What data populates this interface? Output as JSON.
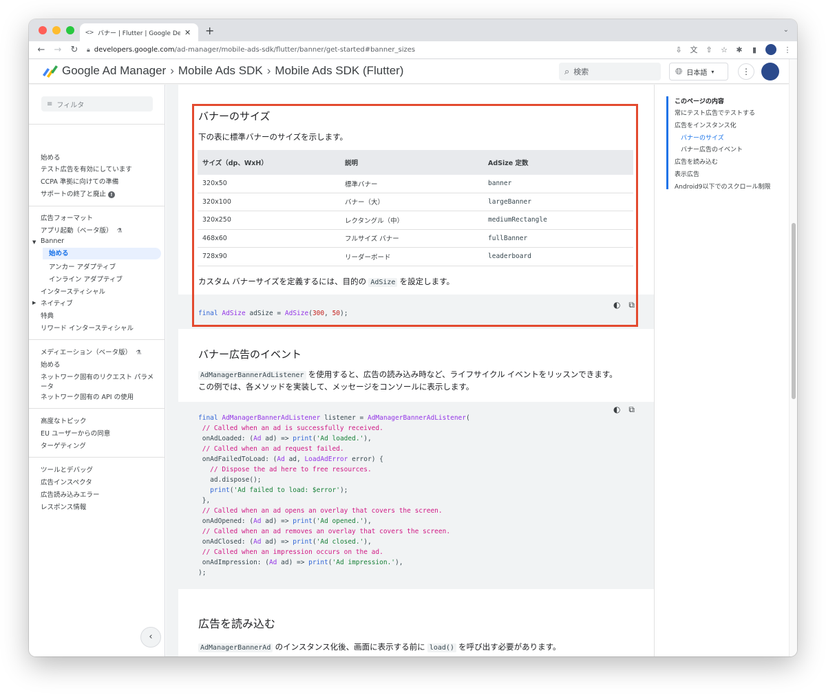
{
  "browser": {
    "tab_title": "バナー | Flutter | Google Developers",
    "tab_favicon": "<>",
    "tab_close": "✕",
    "new_tab": "+",
    "url_host": "developers.google.com",
    "url_path": "/ad-manager/mobile-ads-sdk/flutter/banner/get-started#banner_sizes"
  },
  "header": {
    "brand": "Google Ad Manager",
    "crumb1": "Mobile Ads SDK",
    "crumb2": "Mobile Ads SDK (Flutter)",
    "search_placeholder": "検索",
    "language": "日本語"
  },
  "sidebar": {
    "filter_placeholder": "フィルタ",
    "items": [
      {
        "label": "始める"
      },
      {
        "label": "テスト広告を有効にしています"
      },
      {
        "label": "CCPA 準拠に向けての準備"
      },
      {
        "label": "サポートの終了と廃止"
      },
      {
        "label": "広告フォーマット"
      },
      {
        "label": "アプリ起動（ベータ版）"
      },
      {
        "label": "Banner"
      },
      {
        "label": "始める"
      },
      {
        "label": "アンカー アダプティブ"
      },
      {
        "label": "インライン アダプティブ"
      },
      {
        "label": "インタースティシャル"
      },
      {
        "label": "ネイティブ"
      },
      {
        "label": "特典"
      },
      {
        "label": "リワード インタースティシャル"
      },
      {
        "label": "メディエーション（ベータ版）"
      },
      {
        "label": "始める"
      },
      {
        "label": "ネットワーク固有のリクエスト パラメ"
      },
      {
        "label": "ータ"
      },
      {
        "label": "ネットワーク固有の API の使用"
      },
      {
        "label": "高度なトピック"
      },
      {
        "label": "EU ユーザーからの同意"
      },
      {
        "label": "ターゲティング"
      },
      {
        "label": "ツールとデバッグ"
      },
      {
        "label": "広告インスペクタ"
      },
      {
        "label": "広告読み込みエラー"
      },
      {
        "label": "レスポンス情報"
      }
    ]
  },
  "banner_sizes": {
    "heading": "バナーのサイズ",
    "intro": "下の表に標準バナーのサイズを示します。",
    "columns": [
      "サイズ（dp、WxH）",
      "説明",
      "AdSize 定数"
    ],
    "rows": [
      [
        "320x50",
        "標準バナー",
        "banner"
      ],
      [
        "320x100",
        "バナー（大）",
        "largeBanner"
      ],
      [
        "320x250",
        "レクタングル（中）",
        "mediumRectangle"
      ],
      [
        "468x60",
        "フルサイズ バナー",
        "fullBanner"
      ],
      [
        "728x90",
        "リーダーボード",
        "leaderboard"
      ]
    ],
    "custom_pre": "カスタム バナーサイズを定義するには、目的の",
    "custom_code": "AdSize",
    "custom_post": "を設定します。",
    "code": {
      "kw": "final",
      "type": "AdSize",
      "var": " adSize = ",
      "ctor": "AdSize",
      "open": "(",
      "n1": "300",
      "comma": ", ",
      "n2": "50",
      "close": ");"
    }
  },
  "events": {
    "heading": "バナー広告のイベント",
    "line1_code": "AdManagerBannerAdListener",
    "line1_text": "を使用すると、広告の読み込み時など、ライフサイクル イベントをリッスンできます。",
    "line2": "この例では、各メソッドを実装して、メッセージをコンソールに表示します。",
    "code": {
      "l1_kw": "final",
      "l1_type": "AdManagerBannerAdListener",
      "l1_mid": " listener = ",
      "l1_ctor": "AdManagerBannerAdListener",
      "l1_end": "(",
      "l2": " // Called when an ad is successfully received.",
      "l3_a": " onAdLoaded: (",
      "l3_t": "Ad",
      "l3_b": " ad) => ",
      "l3_fn": "print",
      "l3_c": "(",
      "l3_s": "'Ad loaded.'",
      "l3_d": "),",
      "l4": " // Called when an ad request failed.",
      "l5_a": " onAdFailedToLoad: (",
      "l5_t": "Ad",
      "l5_b": " ad, ",
      "l5_t2": "LoadAdError",
      "l5_c": " error) {",
      "l6": "   // Dispose the ad here to free resources.",
      "l7": "   ad.dispose();",
      "l8_fn": "   print",
      "l8_c": "(",
      "l8_s": "'Ad failed to load: $error'",
      "l8_d": ");",
      "l9": " },",
      "l10": " // Called when an ad opens an overlay that covers the screen.",
      "l11_a": " onAdOpened: (",
      "l11_t": "Ad",
      "l11_b": " ad) => ",
      "l11_fn": "print",
      "l11_c": "(",
      "l11_s": "'Ad opened.'",
      "l11_d": "),",
      "l12": " // Called when an ad removes an overlay that covers the screen.",
      "l13_a": " onAdClosed: (",
      "l13_t": "Ad",
      "l13_b": " ad) => ",
      "l13_fn": "print",
      "l13_c": "(",
      "l13_s": "'Ad closed.'",
      "l13_d": "),",
      "l14": " // Called when an impression occurs on the ad.",
      "l15_a": " onAdImpression: (",
      "l15_t": "Ad",
      "l15_b": " ad) => ",
      "l15_fn": "print",
      "l15_c": "(",
      "l15_s": "'Ad impression.'",
      "l15_d": "),",
      "l16": ");"
    }
  },
  "load": {
    "heading": "広告を読み込む",
    "code": "AdManagerBannerAd",
    "text_a": "のインスタンス化後、画面に表示する前に",
    "code2": "load()",
    "text_b": "を呼び出す必要があります。"
  },
  "toc": {
    "title": "このページの内容",
    "items": [
      {
        "label": "常にテスト広告でテストする"
      },
      {
        "label": "広告をインスタンス化"
      },
      {
        "label": "バナーのサイズ"
      },
      {
        "label": "バナー広告のイベント"
      },
      {
        "label": "広告を読み込む"
      },
      {
        "label": "表示広告"
      },
      {
        "label": "Android9以下でのスクロール制限"
      }
    ]
  },
  "colors": {
    "accent": "#1a73e8",
    "highlight_border": "#e34a2f"
  }
}
